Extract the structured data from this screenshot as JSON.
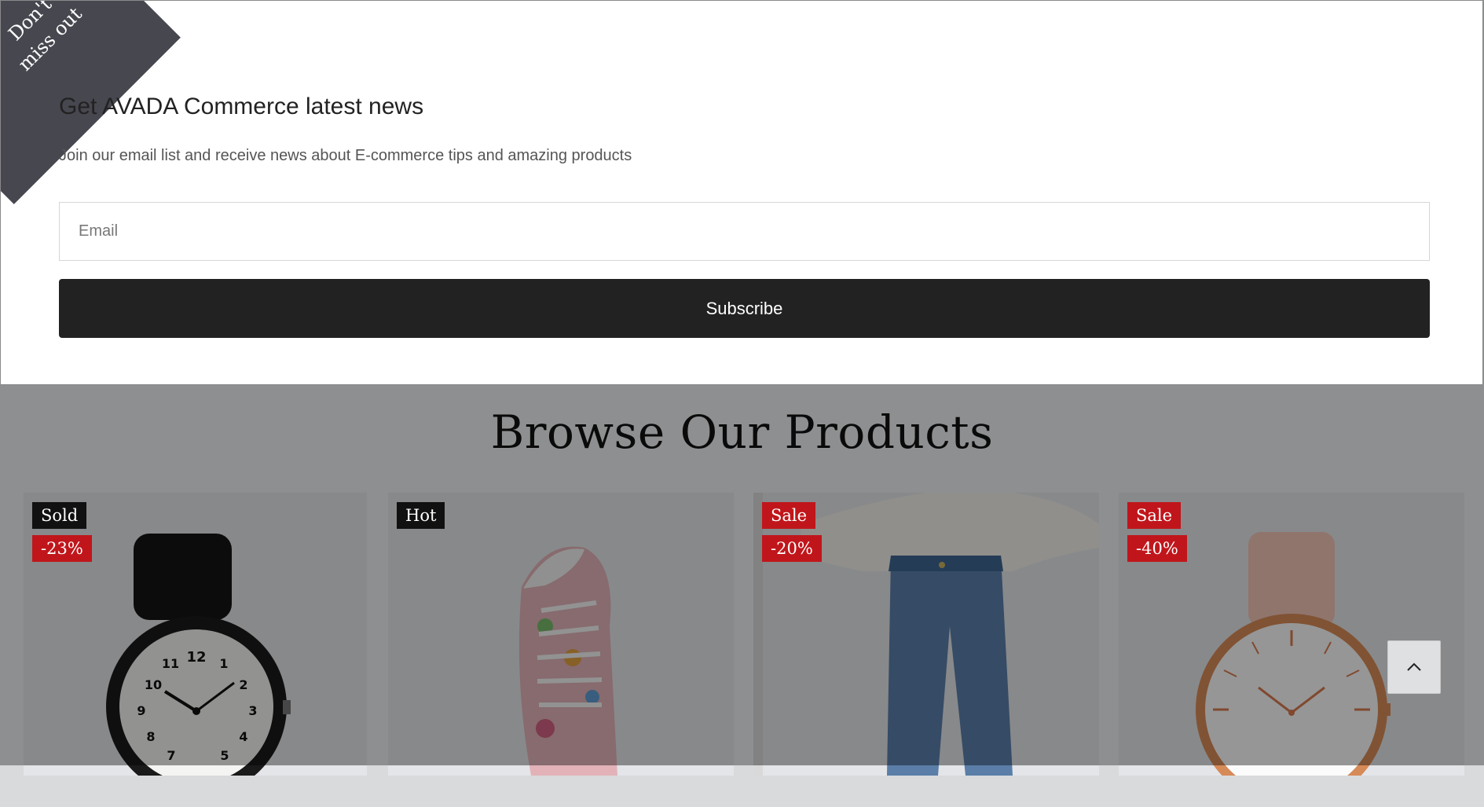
{
  "popup": {
    "ribbon_text": "Don't miss out",
    "title": "Get AVADA Commerce latest news",
    "subtitle": "Join our email list and receive news about E-commerce tips and amazing products",
    "email_placeholder": "Email",
    "email_value": "",
    "subscribe_label": "Subscribe"
  },
  "browse": {
    "title": "Browse Our Products",
    "products": [
      {
        "name": "black-watch",
        "badges": [
          "Sold",
          "-23%"
        ]
      },
      {
        "name": "floral-sneaker",
        "badges": [
          "Hot"
        ]
      },
      {
        "name": "jeans",
        "badges": [
          "Sale",
          "-20%"
        ]
      },
      {
        "name": "pink-watch",
        "badges": [
          "Sale",
          "-40%"
        ]
      }
    ]
  },
  "icons": {
    "back_to_top": "chevron-up-icon"
  },
  "colors": {
    "button_bg": "#222222",
    "ribbon_bg": "#474750",
    "badge_red": "#c0161b",
    "badge_dark": "#111111"
  }
}
